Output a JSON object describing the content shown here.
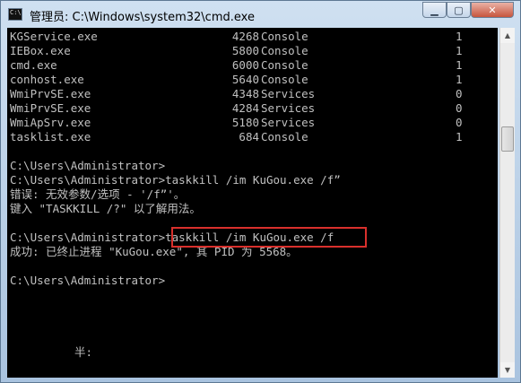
{
  "window": {
    "title": "管理员: C:\\Windows\\system32\\cmd.exe",
    "controls": {
      "minimize": "▁",
      "maximize": "▢",
      "close": "✕"
    }
  },
  "console": {
    "processes": [
      {
        "name": "KGService.exe",
        "pid": "4268",
        "session": "Console",
        "num": "1"
      },
      {
        "name": "IEBox.exe",
        "pid": "5800",
        "session": "Console",
        "num": "1"
      },
      {
        "name": "cmd.exe",
        "pid": "6000",
        "session": "Console",
        "num": "1"
      },
      {
        "name": "conhost.exe",
        "pid": "5640",
        "session": "Console",
        "num": "1"
      },
      {
        "name": "WmiPrvSE.exe",
        "pid": "4348",
        "session": "Services",
        "num": "0"
      },
      {
        "name": "WmiPrvSE.exe",
        "pid": "4284",
        "session": "Services",
        "num": "0"
      },
      {
        "name": "WmiApSrv.exe",
        "pid": "5180",
        "session": "Services",
        "num": "0"
      },
      {
        "name": "tasklist.exe",
        "pid": "684",
        "session": "Console",
        "num": "1"
      }
    ],
    "lines": {
      "prompt1": "C:\\Users\\Administrator>",
      "cmd1": "C:\\Users\\Administrator>taskkill /im KuGou.exe /f”",
      "error1": "错误: 无效参数/选项 - '/f”'。",
      "error2": "键入 \"TASKKILL /?\" 以了解用法。",
      "cmd2": "C:\\Users\\Administrator>taskkill /im KuGou.exe /f",
      "success": "成功: 已终止进程 \"KuGou.exe\", 其 PID 为 5568。",
      "prompt3": "C:\\Users\\Administrator>",
      "ime": "半:"
    }
  }
}
